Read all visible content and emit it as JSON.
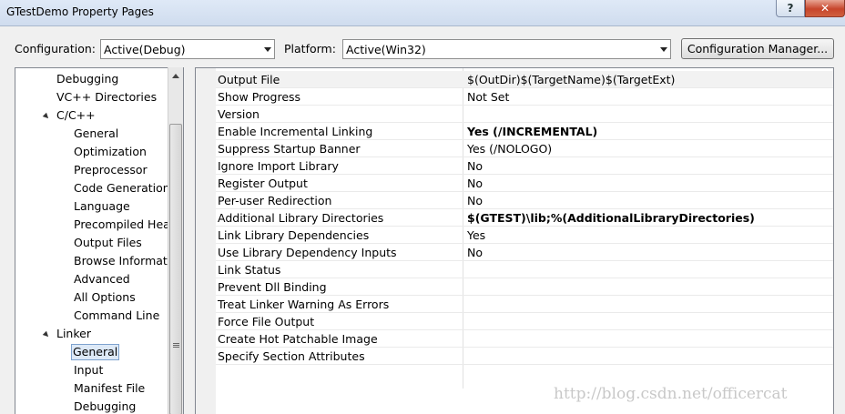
{
  "window": {
    "title": "GTestDemo Property Pages",
    "help_glyph": "?",
    "close_glyph": "✕"
  },
  "toolbar": {
    "configuration_label": "Configuration:",
    "configuration_value": "Active(Debug)",
    "platform_label": "Platform:",
    "platform_value": "Active(Win32)",
    "config_manager_label": "Configuration Manager..."
  },
  "tree": {
    "items": [
      {
        "label": "Debugging"
      },
      {
        "label": "VC++ Directories"
      },
      {
        "label": "C/C++"
      },
      {
        "label": "General"
      },
      {
        "label": "Optimization"
      },
      {
        "label": "Preprocessor"
      },
      {
        "label": "Code Generation"
      },
      {
        "label": "Language"
      },
      {
        "label": "Precompiled Head"
      },
      {
        "label": "Output Files"
      },
      {
        "label": "Browse Informatic"
      },
      {
        "label": "Advanced"
      },
      {
        "label": "All Options"
      },
      {
        "label": "Command Line"
      },
      {
        "label": "Linker"
      },
      {
        "label": "General"
      },
      {
        "label": "Input"
      },
      {
        "label": "Manifest File"
      },
      {
        "label": "Debugging"
      }
    ]
  },
  "properties": [
    {
      "name": "Output File",
      "value": "$(OutDir)$(TargetName)$(TargetExt)"
    },
    {
      "name": "Show Progress",
      "value": "Not Set"
    },
    {
      "name": "Version",
      "value": ""
    },
    {
      "name": "Enable Incremental Linking",
      "value": "Yes (/INCREMENTAL)"
    },
    {
      "name": "Suppress Startup Banner",
      "value": "Yes (/NOLOGO)"
    },
    {
      "name": "Ignore Import Library",
      "value": "No"
    },
    {
      "name": "Register Output",
      "value": "No"
    },
    {
      "name": "Per-user Redirection",
      "value": "No"
    },
    {
      "name": "Additional Library Directories",
      "value": "$(GTEST)\\lib;%(AdditionalLibraryDirectories)"
    },
    {
      "name": "Link Library Dependencies",
      "value": "Yes"
    },
    {
      "name": "Use Library Dependency Inputs",
      "value": "No"
    },
    {
      "name": "Link Status",
      "value": ""
    },
    {
      "name": "Prevent Dll Binding",
      "value": ""
    },
    {
      "name": "Treat Linker Warning As Errors",
      "value": ""
    },
    {
      "name": "Force File Output",
      "value": ""
    },
    {
      "name": "Create Hot Patchable Image",
      "value": ""
    },
    {
      "name": "Specify Section Attributes",
      "value": ""
    }
  ],
  "watermark": "http://blog.csdn.net/officercat"
}
